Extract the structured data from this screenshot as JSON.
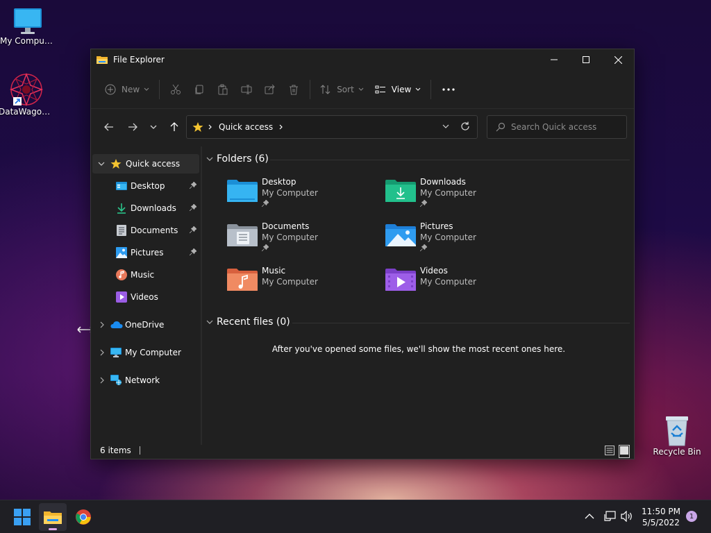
{
  "desktop": {
    "icons": [
      {
        "label": "My Computer"
      },
      {
        "label": "DataWagon..."
      },
      {
        "label": "Recycle Bin"
      }
    ]
  },
  "window": {
    "title": "File Explorer",
    "toolbar": {
      "new_label": "New",
      "sort_label": "Sort",
      "view_label": "View"
    },
    "address": {
      "path_label": "Quick access"
    },
    "search": {
      "placeholder": "Search Quick access"
    },
    "sidebar": {
      "quick_access": "Quick access",
      "items": [
        {
          "label": "Desktop"
        },
        {
          "label": "Downloads"
        },
        {
          "label": "Documents"
        },
        {
          "label": "Pictures"
        },
        {
          "label": "Music"
        },
        {
          "label": "Videos"
        }
      ],
      "onedrive": "OneDrive",
      "my_computer": "My Computer",
      "network": "Network"
    },
    "folders_header": "Folders (6)",
    "folders": [
      {
        "name": "Desktop",
        "location": "My Computer",
        "pinned": true
      },
      {
        "name": "Downloads",
        "location": "My Computer",
        "pinned": true
      },
      {
        "name": "Documents",
        "location": "My Computer",
        "pinned": true
      },
      {
        "name": "Pictures",
        "location": "My Computer",
        "pinned": true
      },
      {
        "name": "Music",
        "location": "My Computer",
        "pinned": false
      },
      {
        "name": "Videos",
        "location": "My Computer",
        "pinned": false
      }
    ],
    "recent_header": "Recent files (0)",
    "recent_empty": "After you've opened some files, we'll show the most recent ones here.",
    "status": {
      "item_count": "6 items"
    }
  },
  "taskbar": {
    "clock_time": "11:50 PM",
    "clock_date": "5/5/2022",
    "notification_count": "1"
  },
  "colors": {
    "accent": "#4cc2ff",
    "window_bg": "#202020",
    "folder_star": "#f4c430"
  }
}
